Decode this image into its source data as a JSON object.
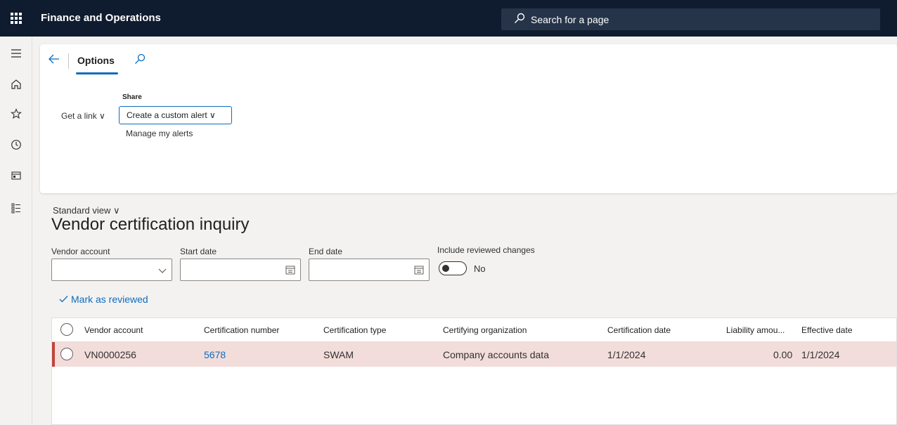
{
  "header": {
    "app_title": "Finance and Operations",
    "search_placeholder": "Search for a page"
  },
  "action_pane": {
    "tab_label": "Options",
    "group_label": "Share",
    "get_link": "Get a link ∨",
    "custom_alert": "Create a custom alert ∨",
    "manage_alerts": "Manage my alerts"
  },
  "page": {
    "view_name": "Standard view ∨",
    "title": "Vendor certification inquiry"
  },
  "filters": {
    "vendor_account_label": "Vendor account",
    "start_date_label": "Start date",
    "end_date_label": "End date",
    "include_reviewed_label": "Include reviewed changes",
    "include_reviewed_value": "No"
  },
  "actions": {
    "mark_reviewed": "Mark as reviewed"
  },
  "grid": {
    "columns": [
      "Vendor account",
      "Certification number",
      "Certification type",
      "Certifying organization",
      "Certification date",
      "Liability amou...",
      "Effective date"
    ],
    "rows": [
      {
        "vendor_account": "VN0000256",
        "cert_number": "5678",
        "cert_type": "SWAM",
        "organization": "Company accounts data",
        "cert_date": "1/1/2024",
        "liability": "0.00",
        "effective_date": "1/1/2024"
      }
    ]
  },
  "colors": {
    "accent": "#0f6cbd",
    "topbar": "#0f1b2e",
    "row_highlight": "#f2dddb",
    "row_marker": "#c2433c"
  }
}
